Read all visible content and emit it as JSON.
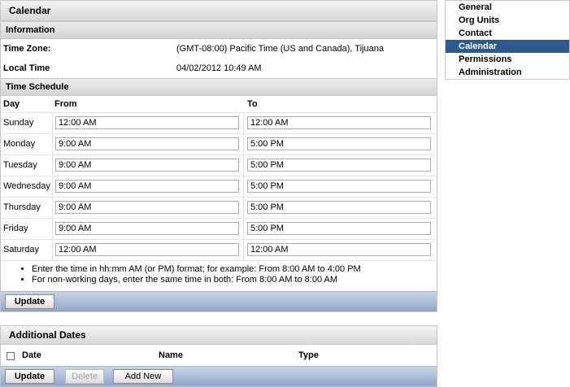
{
  "panel": {
    "title": "Calendar",
    "info_header": "Information",
    "time_zone_label": "Time Zone:",
    "time_zone_value": "(GMT-08:00) Pacific Time (US and Canada), Tijuana",
    "local_time_label": "Local Time",
    "local_time_value": "04/02/2012 10:49 AM",
    "schedule_header": "Time Schedule",
    "col_day": "Day",
    "col_from": "From",
    "col_to": "To",
    "rows": [
      {
        "day": "Sunday",
        "from": "12:00 AM",
        "to": "12:00 AM"
      },
      {
        "day": "Monday",
        "from": "9:00 AM",
        "to": "5:00 PM"
      },
      {
        "day": "Tuesday",
        "from": "9:00 AM",
        "to": "5:00 PM"
      },
      {
        "day": "Wednesday",
        "from": "9:00 AM",
        "to": "5:00 PM"
      },
      {
        "day": "Thursday",
        "from": "9:00 AM",
        "to": "5:00 PM"
      },
      {
        "day": "Friday",
        "from": "9:00 AM",
        "to": "5:00 PM"
      },
      {
        "day": "Saturday",
        "from": "12:00 AM",
        "to": "12:00 AM"
      }
    ],
    "notes": [
      "Enter the time in hh:mm AM (or PM) format; for example: From 8:00 AM to 4:00 PM",
      "For non-working days, enter the same time in both: From 8:00 AM to 8:00 AM"
    ],
    "update_label": "Update"
  },
  "additional": {
    "title": "Additional Dates",
    "col_date": "Date",
    "col_name": "Name",
    "col_type": "Type",
    "update_label": "Update",
    "delete_label": "Delete",
    "add_new_label": "Add New"
  },
  "nav": {
    "items": [
      "General",
      "Org Units",
      "Contact",
      "Calendar",
      "Permissions",
      "Administration"
    ],
    "active": "Calendar"
  }
}
